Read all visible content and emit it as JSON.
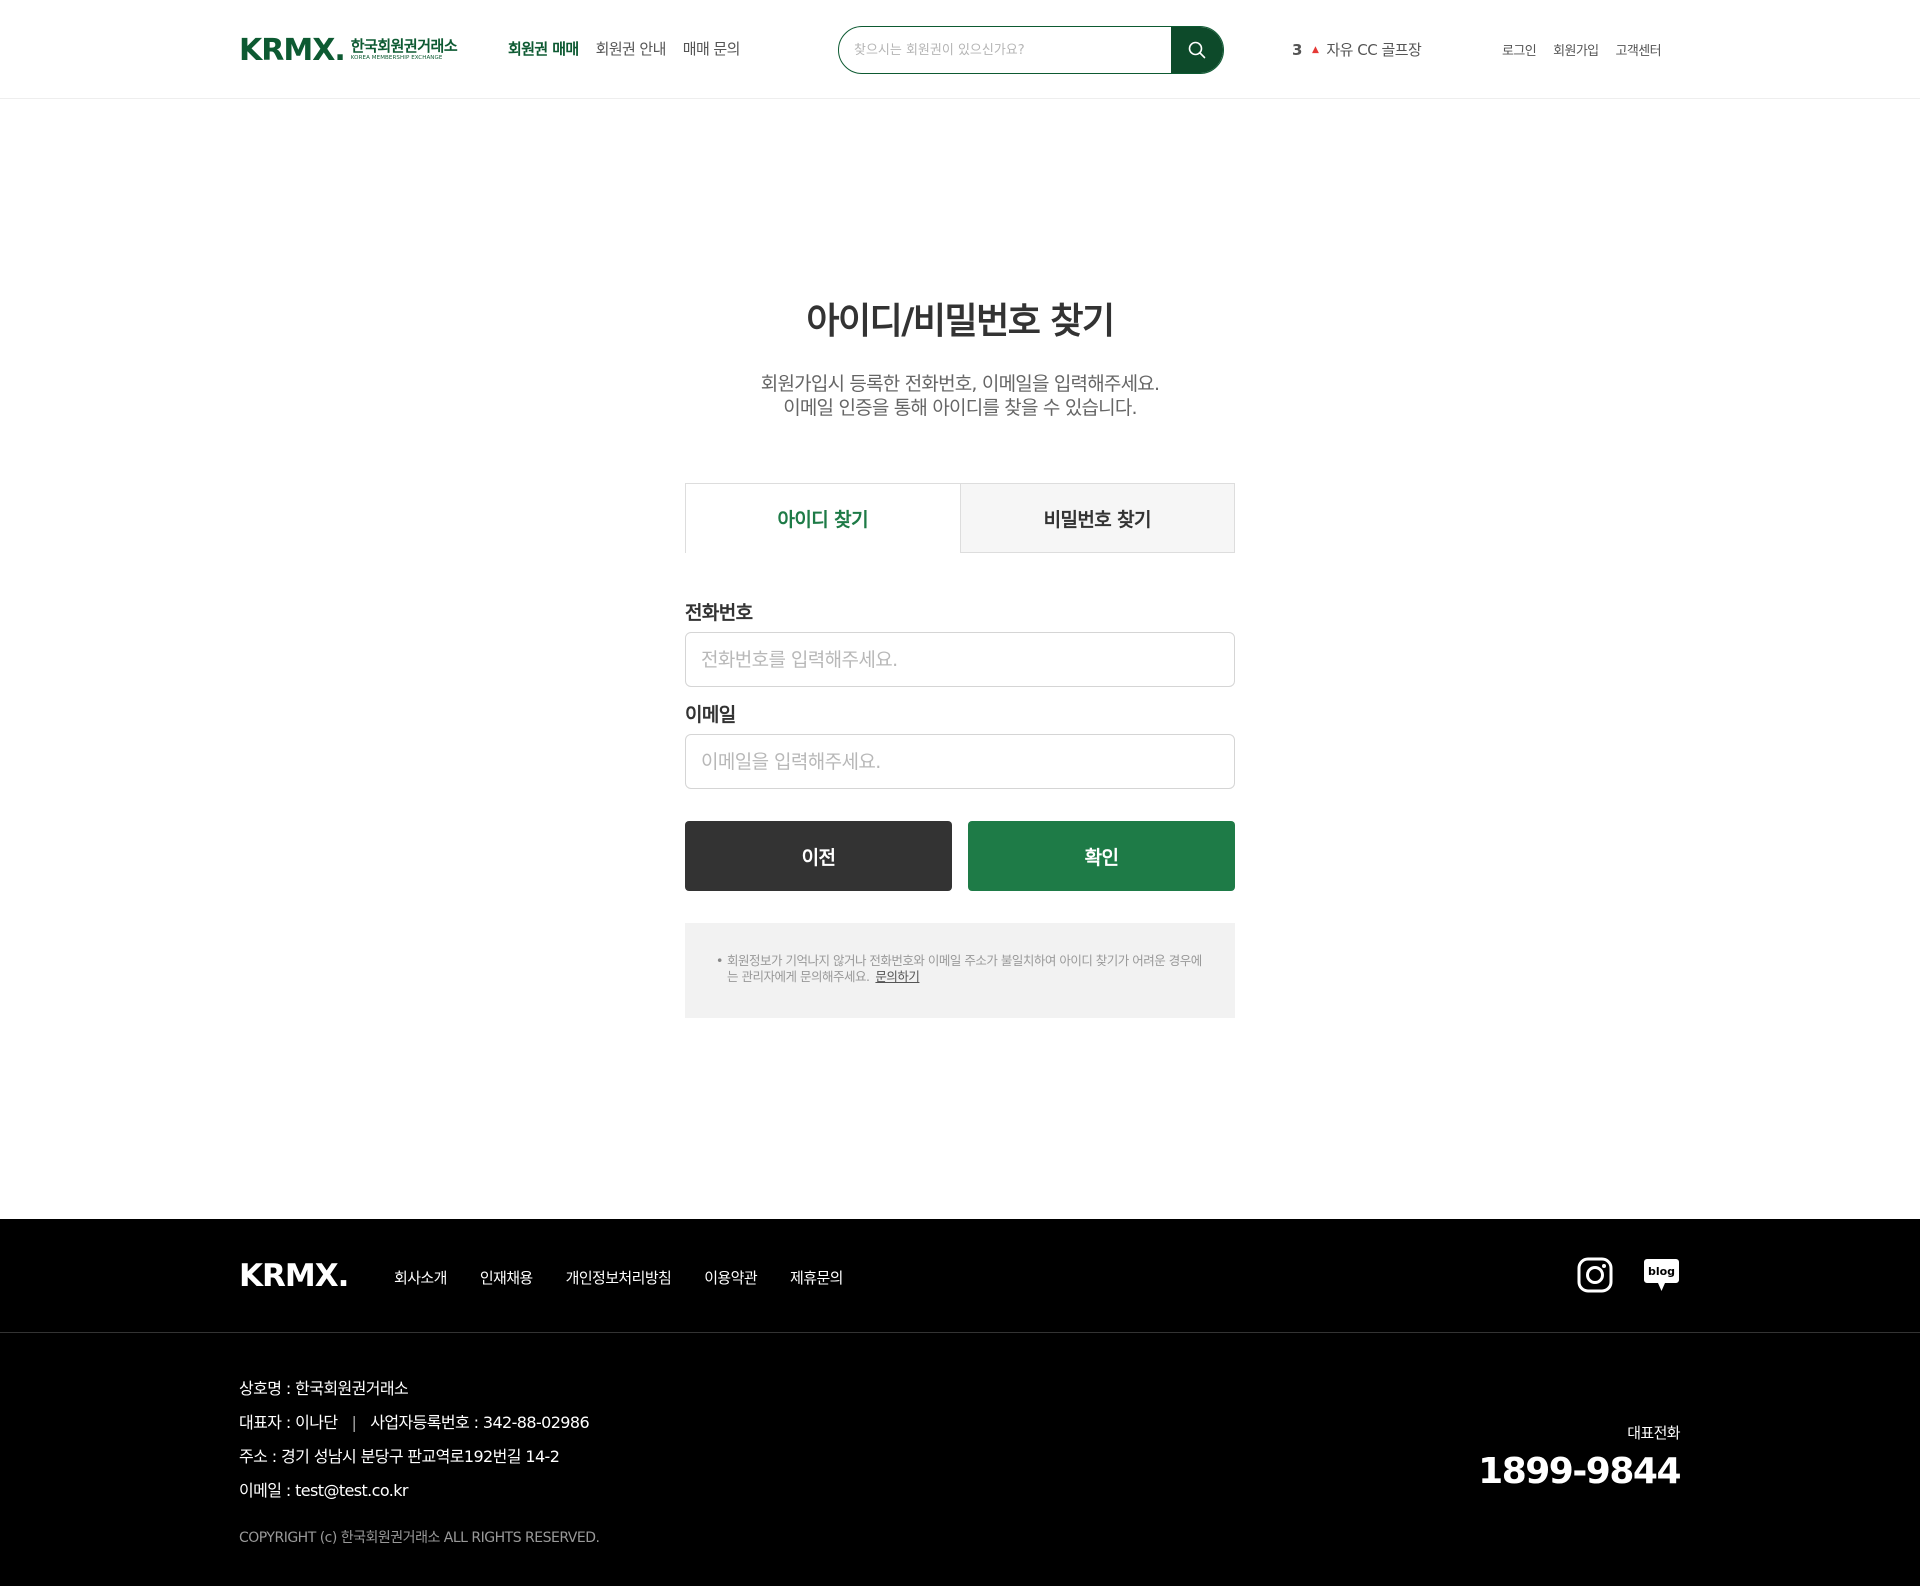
{
  "header": {
    "logo_mark": "KRMX.",
    "logo_ko": "한국회원권거래소",
    "logo_en": "KOREA MEMBERSHIP EXCHANGE",
    "nav": [
      "회원권 매매",
      "회원권 안내",
      "매매 문의"
    ],
    "search_placeholder": "찾으시는 회원권이 있으신가요?",
    "ranking": {
      "rank": "3",
      "name": "자유 CC 골프장"
    },
    "util": [
      "로그인",
      "회원가입",
      "고객센터"
    ]
  },
  "main": {
    "title": "아이디/비밀번호 찾기",
    "desc_line1": "회원가입시 등록한 전화번호, 이메일을 입력해주세요.",
    "desc_line2": "이메일 인증을 통해 아이디를 찾을 수 있습니다.",
    "tabs": [
      "아이디 찾기",
      "비밀번호 찾기"
    ],
    "phone_label": "전화번호",
    "phone_placeholder": "전화번호를 입력해주세요.",
    "email_label": "이메일",
    "email_placeholder": "이메일을 입력해주세요.",
    "prev_button": "이전",
    "confirm_button": "확인",
    "notice_text": "회원정보가 기억나지 않거나 전화번호와 이메일 주소가 불일치하여 아이디 찾기가 어려운 경우에는 관리자에게 문의해주세요.",
    "notice_link": "문의하기"
  },
  "footer": {
    "logo": "KRMX.",
    "nav": [
      "회사소개",
      "인재채용",
      "개인정보처리방침",
      "이용약관",
      "제휴문의"
    ],
    "blog_label": "blog",
    "company": "상호명 : 한국회원권거래소",
    "ceo": "대표자 : 이나단",
    "biz_no": "사업자등록번호 : 342-88-02986",
    "address": "주소 : 경기 성남시 분당구 판교역로192번길 14-2",
    "email": "이메일 : test@test.co.kr",
    "copyright": "COPYRIGHT (c) 한국회원권거래소 ALL RIGHTS RESERVED.",
    "tel_label": "대표전화",
    "tel": "1899-9844"
  },
  "colors": {
    "brand_green": "#0d5a32",
    "accent_green": "#1e7b47",
    "dark_button": "#333333",
    "rank_up": "#e53935",
    "footer_bg": "#000000"
  },
  "icons": [
    "search-icon",
    "rank-up-icon",
    "instagram-icon",
    "blog-icon"
  ]
}
